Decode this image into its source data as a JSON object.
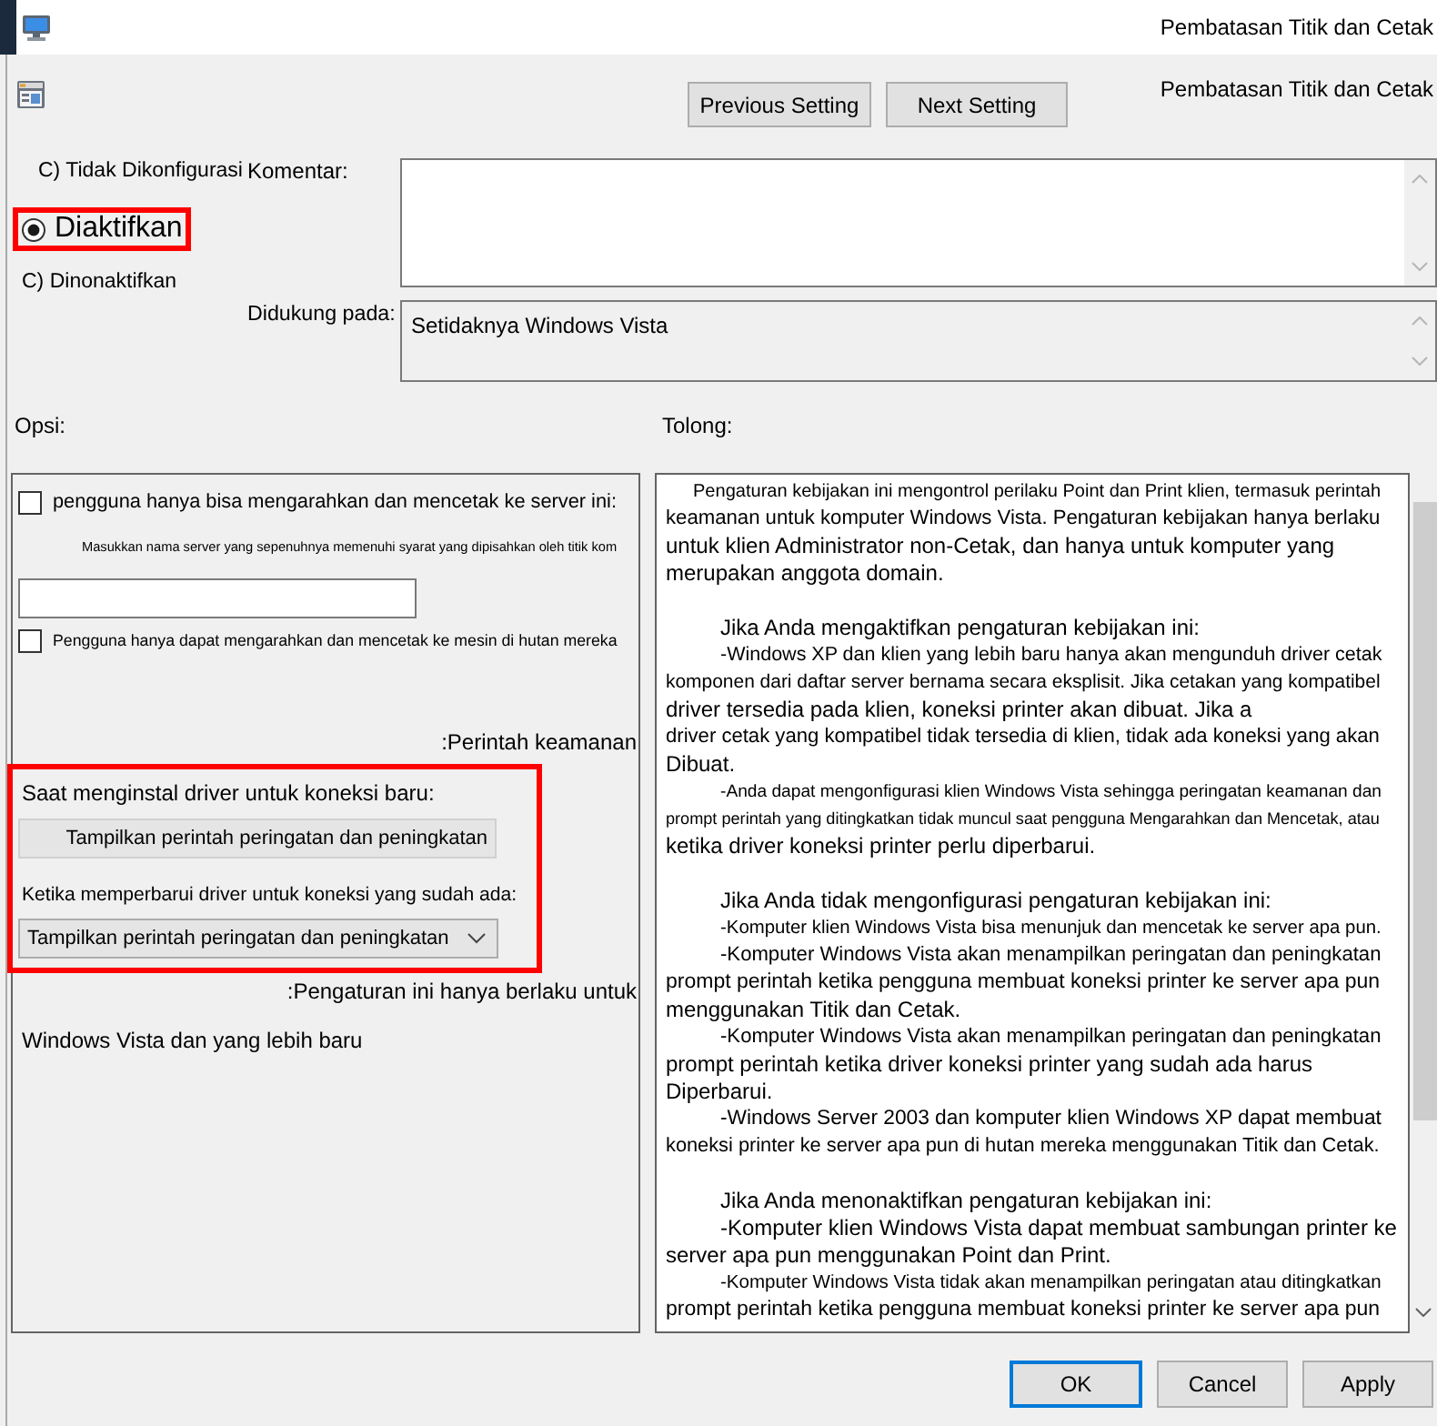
{
  "window": {
    "title": "Pembatasan Titik dan Cetak"
  },
  "toolbar": {
    "buttons": [
      {
        "label": "Previous Setting"
      },
      {
        "label": "Next Setting"
      }
    ],
    "setting_name": "Pembatasan Titik dan Cetak"
  },
  "state_options": [
    {
      "label": "C) Tidak Dikonfigurasi",
      "selected": false,
      "highlighted": false
    },
    {
      "label": "Diaktifkan",
      "selected": true,
      "highlighted": true
    },
    {
      "label": "C) Dinonaktifkan",
      "selected": false,
      "highlighted": false
    }
  ],
  "comment": {
    "label": "Komentar:"
  },
  "supported_on": {
    "label": "Didukung pada:",
    "value": "Setidaknya Windows Vista"
  },
  "options": {
    "heading": "Opsi:",
    "server_checkbox": {
      "label": "pengguna hanya bisa mengarahkan dan mencetak ke server ini:",
      "checked": false
    },
    "server_note": "Masukkan nama server yang sepenuhnya memenuhi syarat yang dipisahkan oleh titik kom",
    "forest_checkbox": {
      "label": "Pengguna hanya dapat mengarahkan dan mencetak ke mesin di hutan mereka",
      "checked": false
    },
    "security_heading": ":Perintah keamanan",
    "security_group": {
      "highlighted": true,
      "fields": [
        {
          "kind": "static",
          "label": "Saat menginstal driver untuk koneksi baru:",
          "value": "Tampilkan perintah peringatan dan peningkatan"
        },
        {
          "kind": "dropdown",
          "label": "Ketika memperbarui driver untuk koneksi yang sudah ada:",
          "value": "Tampilkan perintah peringatan dan peningkatan"
        }
      ]
    },
    "scope_heading": ":Pengaturan ini hanya berlaku untuk",
    "scope_text": "Windows Vista dan yang lebih baru"
  },
  "help": {
    "heading": "Tolong:",
    "paragraphs": [
      {
        "lines": [
          {
            "kind": "lead",
            "text": "Pengaturan kebijakan ini mengontrol perilaku Point dan Print klien, termasuk perintah"
          },
          {
            "kind": "cont",
            "text": "keamanan untuk komputer Windows Vista. Pengaturan kebijakan hanya berlaku"
          },
          {
            "kind": "cont",
            "text": "untuk klien Administrator non-Cetak, dan hanya untuk komputer yang"
          },
          {
            "kind": "cont",
            "text": "merupakan anggota domain."
          }
        ]
      },
      {
        "lines": [
          {
            "kind": "indent",
            "text": "Jika Anda mengaktifkan pengaturan kebijakan ini:"
          },
          {
            "kind": "indent",
            "text": "-Windows XP dan klien yang lebih baru hanya akan mengunduh driver cetak"
          },
          {
            "kind": "cont",
            "text": "komponen dari daftar server bernama secara eksplisit. Jika cetakan yang kompatibel"
          },
          {
            "kind": "cont",
            "text": "driver tersedia pada klien, koneksi printer akan dibuat. Jika a"
          },
          {
            "kind": "cont",
            "text": "driver cetak yang kompatibel tidak tersedia di klien, tidak ada koneksi yang akan"
          },
          {
            "kind": "cont",
            "text": "Dibuat."
          },
          {
            "kind": "indent",
            "text": "-Anda dapat mengonfigurasi klien Windows Vista sehingga peringatan keamanan dan"
          },
          {
            "kind": "cont",
            "text": "prompt perintah yang ditingkatkan tidak muncul saat pengguna Mengarahkan dan Mencetak, atau"
          },
          {
            "kind": "cont",
            "text": "ketika driver koneksi printer perlu diperbarui."
          }
        ]
      },
      {
        "lines": [
          {
            "kind": "indent",
            "text": "Jika Anda tidak mengonfigurasi pengaturan kebijakan ini:"
          },
          {
            "kind": "indent",
            "text": "-Komputer klien Windows Vista bisa menunjuk dan mencetak ke server apa pun."
          },
          {
            "kind": "indent",
            "text": "-Komputer Windows Vista akan menampilkan peringatan dan peningkatan"
          },
          {
            "kind": "cont",
            "text": "prompt perintah ketika pengguna membuat koneksi printer ke server apa pun"
          },
          {
            "kind": "cont",
            "text": "menggunakan Titik dan Cetak."
          },
          {
            "kind": "indent",
            "text": "-Komputer Windows Vista akan menampilkan peringatan dan peningkatan"
          },
          {
            "kind": "cont",
            "text": "prompt perintah ketika driver koneksi printer yang sudah ada harus"
          },
          {
            "kind": "cont",
            "text": "Diperbarui."
          },
          {
            "kind": "indent",
            "text": "-Windows Server 2003 dan komputer klien Windows XP dapat membuat"
          },
          {
            "kind": "cont",
            "text": "koneksi printer ke server apa pun di hutan mereka menggunakan Titik dan Cetak."
          }
        ]
      },
      {
        "lines": [
          {
            "kind": "indent",
            "text": "Jika Anda menonaktifkan pengaturan kebijakan ini:"
          },
          {
            "kind": "indent",
            "text": "-Komputer klien Windows Vista dapat membuat sambungan printer ke"
          },
          {
            "kind": "cont",
            "text": "server apa pun menggunakan Point dan Print."
          },
          {
            "kind": "indent",
            "text": "-Komputer Windows Vista tidak akan menampilkan peringatan atau ditingkatkan"
          },
          {
            "kind": "cont",
            "text": "prompt perintah ketika pengguna membuat koneksi printer ke server apa pun"
          }
        ]
      }
    ]
  },
  "footer_buttons": [
    {
      "label": "OK",
      "default": true
    },
    {
      "label": "Cancel",
      "default": false
    },
    {
      "label": "Apply",
      "default": false
    }
  ]
}
